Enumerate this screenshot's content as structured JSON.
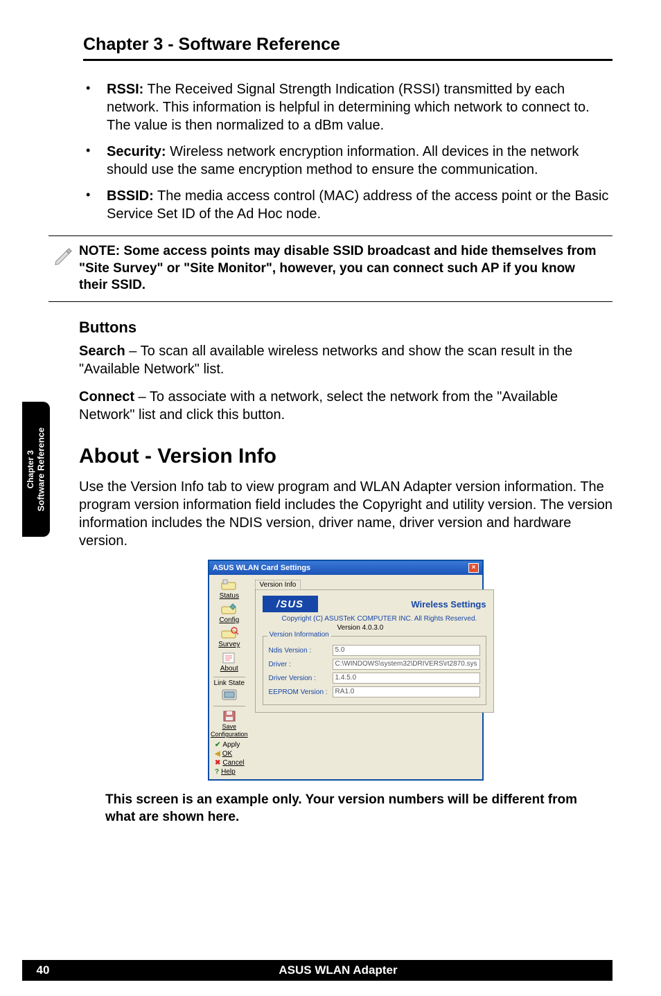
{
  "chapter_header": "Chapter 3 - Software Reference",
  "side_tab": {
    "line1": "Chapter 3",
    "line2": "Software Reference"
  },
  "bullets": [
    {
      "label": "RSSI:",
      "text": " The Received Signal Strength Indication (RSSI) transmitted by each network. This information is helpful in determining which network to connect to. The value is then normalized to a dBm value."
    },
    {
      "label": "Security:",
      "text": " Wireless network encryption information. All devices in the network should use the same encryption method to ensure the communication."
    },
    {
      "label": "BSSID:",
      "text": " The media access control (MAC) address of the access point or the Basic Service Set ID of the Ad Hoc node."
    }
  ],
  "note": "NOTE: Some access points may disable SSID broadcast and hide themselves from \"Site Survey\" or \"Site Monitor\", however, you can connect such AP if you know their SSID.",
  "buttons_heading": "Buttons",
  "search_label": "Search",
  "search_text": " – To scan all available wireless networks and show the scan result in the \"Available Network\" list.",
  "connect_label": "Connect",
  "connect_text": " – To associate with a network, select the network from the \"Available Network\" list and click this button.",
  "about_heading": "About - Version Info",
  "about_para": "Use the Version Info tab to view program and WLAN Adapter version information. The program version information field includes the Copyright and utility version. The version information includes the NDIS version, driver name, driver version and hardware version.",
  "dialog": {
    "title": "ASUS WLAN Card Settings",
    "tab": "Version Info",
    "brand": "/SUS",
    "wireless": "Wireless Settings",
    "copyright": "Copyright (C) ASUSTeK COMPUTER INC. All Rights Reserved.",
    "version_top": "Version 4.0.3.0",
    "group_label": "Version Information",
    "rows": {
      "ndis_label": "Ndis Version :",
      "ndis_value": "5.0",
      "driver_label": "Driver :",
      "driver_value": "C:\\WINDOWS\\system32\\DRIVERS\\rt2870.sys",
      "drvver_label": "Driver Version :",
      "drvver_value": "1.4.5.0",
      "eeprom_label": "EEPROM Version :",
      "eeprom_value": "RA1.0"
    },
    "sidebar": {
      "status": "Status",
      "config": "Config",
      "survey": "Survey",
      "about": "About",
      "linkstate": "Link State",
      "savecfg": "Save Configuration",
      "apply": "Apply",
      "ok": "OK",
      "cancel": "Cancel",
      "help": "Help"
    }
  },
  "caption": "This screen is an example only. Your version numbers will be different from what are shown here.",
  "footer": {
    "page": "40",
    "title": "ASUS WLAN Adapter"
  }
}
